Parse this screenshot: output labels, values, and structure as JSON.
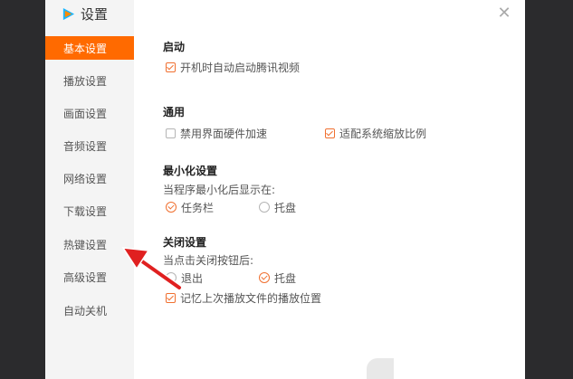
{
  "app": {
    "title": "设置"
  },
  "colors": {
    "accent": "#ff6a00",
    "check": "#f07030",
    "arrow": "#e02020"
  },
  "sidebar": {
    "items": [
      {
        "label": "基本设置",
        "active": true
      },
      {
        "label": "播放设置",
        "active": false
      },
      {
        "label": "画面设置",
        "active": false
      },
      {
        "label": "音频设置",
        "active": false
      },
      {
        "label": "网络设置",
        "active": false
      },
      {
        "label": "下载设置",
        "active": false
      },
      {
        "label": "热键设置",
        "active": false
      },
      {
        "label": "高级设置",
        "active": false
      },
      {
        "label": "自动关机",
        "active": false
      }
    ]
  },
  "sections": {
    "startup": {
      "title": "启动",
      "opt_autostart": "开机时自动启动腾讯视频",
      "autostart_checked": true
    },
    "general": {
      "title": "通用",
      "opt_disable_hw": "禁用界面硬件加速",
      "disable_hw_checked": false,
      "opt_adapt_scale": "适配系统缩放比例",
      "adapt_scale_checked": true
    },
    "minimize": {
      "title": "最小化设置",
      "prompt": "当程序最小化后显示在:",
      "opt_taskbar": "任务栏",
      "opt_tray": "托盘",
      "selected": "任务栏"
    },
    "close": {
      "title": "关闭设置",
      "prompt": "当点击关闭按钮后:",
      "opt_exit": "退出",
      "opt_tray": "托盘",
      "selected": "托盘",
      "opt_remember": "记忆上次播放文件的播放位置",
      "remember_checked": true
    }
  },
  "icons": {
    "close": "close-icon",
    "logo": "play-logo-icon",
    "annotation": "red-arrow"
  }
}
